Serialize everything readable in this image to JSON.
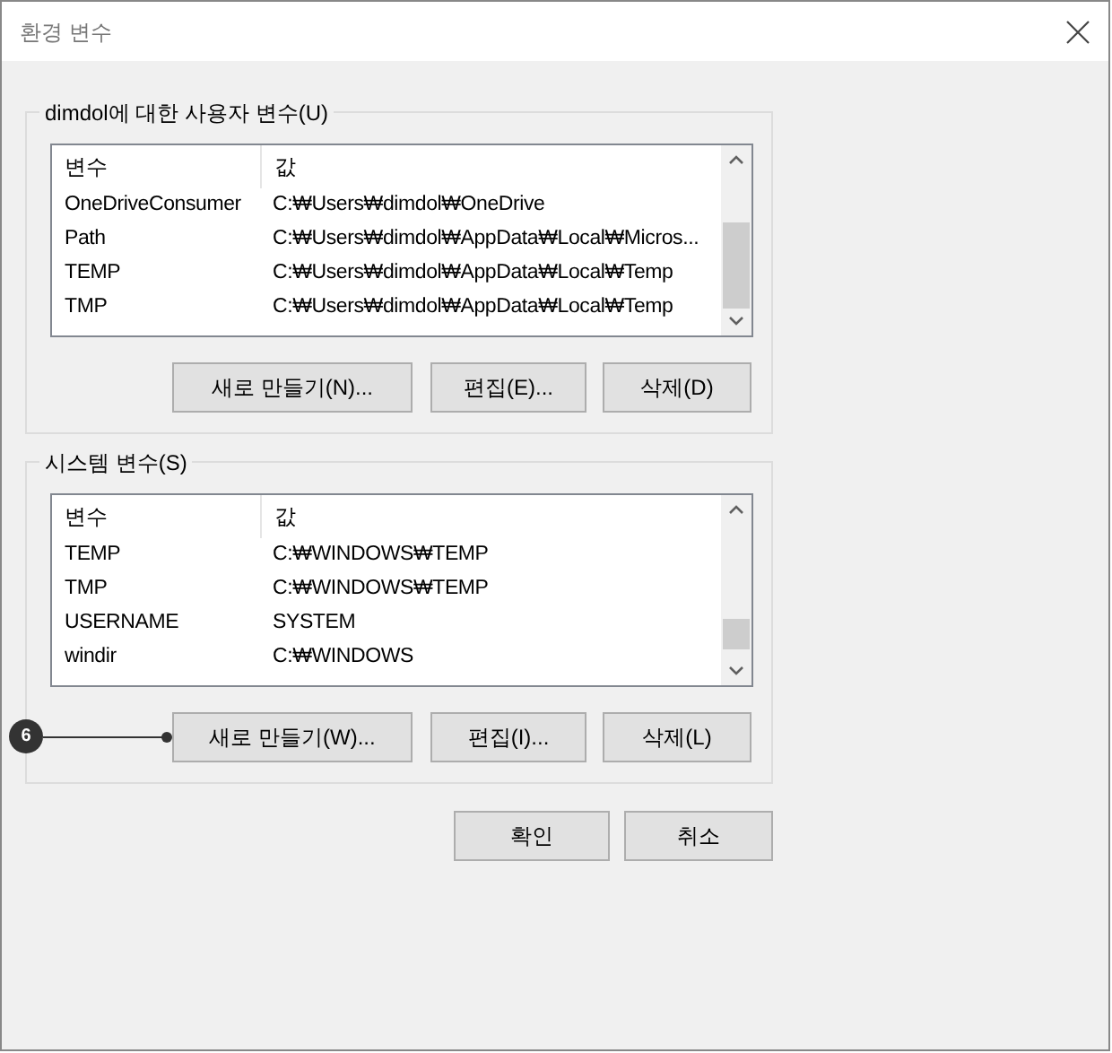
{
  "window": {
    "title": "환경 변수"
  },
  "user_variables": {
    "title": "dimdol에 대한 사용자 변수(U)",
    "columns": [
      "변수",
      "값"
    ],
    "rows": [
      [
        "OneDriveConsumer",
        "C:₩Users₩dimdol₩OneDrive"
      ],
      [
        "Path",
        "C:₩Users₩dimdol₩AppData₩Local₩Micros..."
      ],
      [
        "TEMP",
        "C:₩Users₩dimdol₩AppData₩Local₩Temp"
      ],
      [
        "TMP",
        "C:₩Users₩dimdol₩AppData₩Local₩Temp"
      ]
    ],
    "buttons": [
      "새로 만들기(N)...",
      "편집(E)...",
      "삭제(D)"
    ]
  },
  "system_variables": {
    "title": "시스템 변수(S)",
    "columns": [
      "변수",
      "값"
    ],
    "rows": [
      [
        "TEMP",
        "C:₩WINDOWS₩TEMP"
      ],
      [
        "TMP",
        "C:₩WINDOWS₩TEMP"
      ],
      [
        "USERNAME",
        "SYSTEM"
      ],
      [
        "windir",
        "C:₩WINDOWS"
      ]
    ],
    "buttons": [
      "새로 만들기(W)...",
      "편집(I)...",
      "삭제(L)"
    ],
    "callout": {
      "label": "6"
    }
  },
  "buttons": [
    "확인",
    "취소"
  ]
}
